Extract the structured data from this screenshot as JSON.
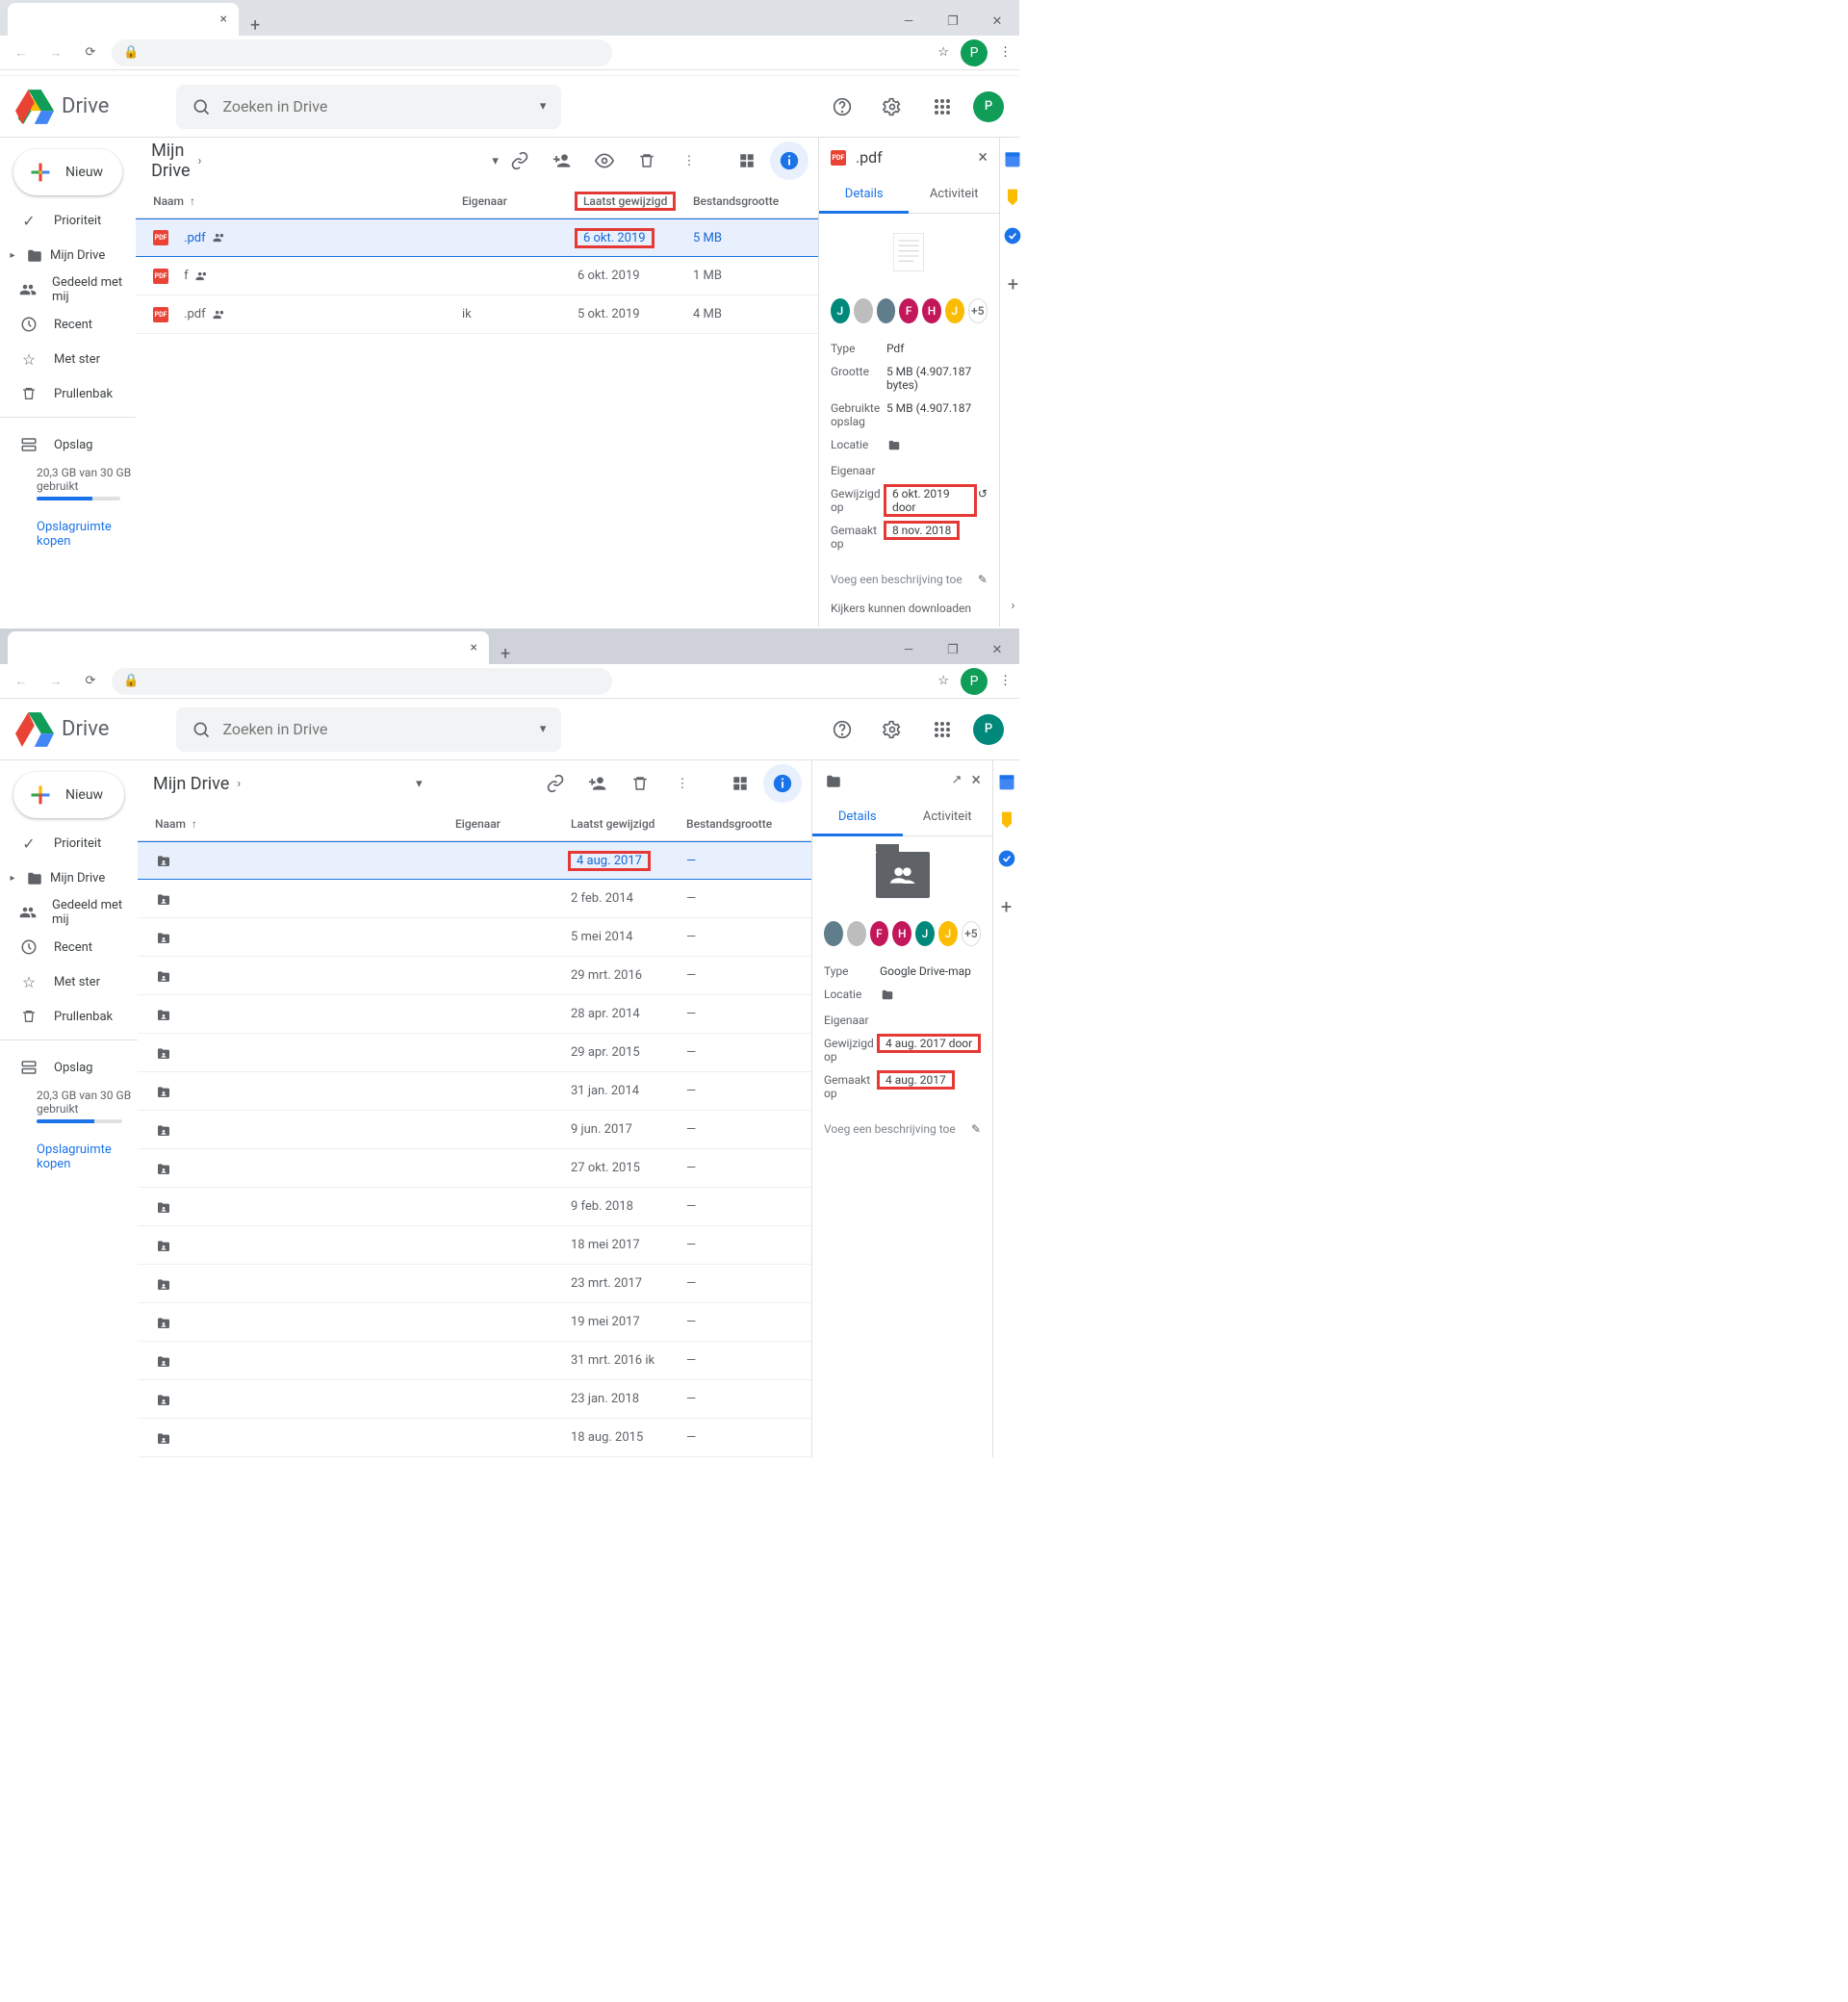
{
  "browser": {
    "win_min": "—",
    "win_max": "❐",
    "win_close": "✕",
    "tab_close": "×",
    "tab_plus": "+",
    "star": "☆",
    "menu": "⋮"
  },
  "avatar_letter": "P",
  "drive": {
    "product": "Drive",
    "search_placeholder": "Zoeken in Drive",
    "new_label": "Nieuw",
    "sidebar": {
      "priority": "Prioriteit",
      "mydrive": "Mijn Drive",
      "shared": "Gedeeld met mij",
      "recent": "Recent",
      "starred": "Met ster",
      "trash": "Prullenbak",
      "storage": "Opslag",
      "storage_text": "20,3 GB van 30 GB gebruikt",
      "upgrade": "Opslagruimte kopen"
    },
    "breadcrumb": "Mijn Drive",
    "cols": {
      "name": "Naam",
      "owner": "Eigenaar",
      "date": "Laatst gewijzigd",
      "size": "Bestandsgrootte"
    },
    "tabs": {
      "details": "Details",
      "activity": "Activiteit"
    },
    "detail_labels": {
      "type": "Type",
      "size": "Grootte",
      "storage_used": "Gebruikte opslag",
      "location": "Locatie",
      "owner": "Eigenaar",
      "modified": "Gewijzigd op",
      "created": "Gemaakt op",
      "add_desc": "Voeg een beschrijving toe",
      "viewers_dl": "Kijkers kunnen downloaden"
    }
  },
  "top": {
    "rows": [
      {
        "name": ".pdf",
        "shared": true,
        "owner": "",
        "date": "6 okt. 2019",
        "size": "5 MB",
        "sel": true,
        "hl_date": true
      },
      {
        "name": "f",
        "shared": true,
        "owner": "",
        "date": "6 okt. 2019",
        "size": "1 MB"
      },
      {
        "name": ".pdf",
        "shared": true,
        "owner": "ik",
        "date": "5 okt. 2019",
        "size": "4 MB"
      }
    ],
    "details": {
      "title": ".pdf",
      "type": "Pdf",
      "size": "5 MB (4.907.187 bytes)",
      "storage_used": "5 MB (4.907.187",
      "modified": "6 okt. 2019 door",
      "created": "8 nov. 2018",
      "avatars": [
        {
          "bg": "#00897b",
          "t": "J"
        },
        {
          "bg": "#bdbdbd",
          "t": ""
        },
        {
          "bg": "#607d8b",
          "t": ""
        },
        {
          "bg": "#c2185b",
          "t": "F"
        },
        {
          "bg": "#c2185b",
          "t": "H"
        },
        {
          "bg": "#fbbc04",
          "t": "J"
        }
      ],
      "more": "+5"
    }
  },
  "bottom": {
    "rows": [
      {
        "date": "4 aug. 2017",
        "size": "—",
        "sel": true,
        "hl_date": true
      },
      {
        "date": "2 feb. 2014",
        "size": "—"
      },
      {
        "date": "5 mei 2014",
        "size": "—"
      },
      {
        "date": "29 mrt. 2016",
        "size": "—"
      },
      {
        "date": "28 apr. 2014",
        "size": "—"
      },
      {
        "date": "29 apr. 2015",
        "size": "—"
      },
      {
        "date": "31 jan. 2014",
        "size": "—"
      },
      {
        "date": "9 jun. 2017",
        "size": "—"
      },
      {
        "date": "27 okt. 2015",
        "size": "—"
      },
      {
        "date": "9 feb. 2018",
        "size": "—"
      },
      {
        "date": "18 mei 2017",
        "size": "—"
      },
      {
        "date": "23 mrt. 2017",
        "size": "—"
      },
      {
        "date": "19 mei 2017",
        "size": "—"
      },
      {
        "date": "31 mrt. 2016 ik",
        "size": "—"
      },
      {
        "date": "23 jan. 2018",
        "size": "—"
      },
      {
        "date": "18 aug. 2015",
        "size": "—"
      }
    ],
    "details": {
      "title": "",
      "type": "Google Drive-map",
      "modified": "4 aug. 2017 door",
      "created": "4 aug. 2017",
      "avatars": [
        {
          "bg": "#607d8b",
          "t": ""
        },
        {
          "bg": "#bdbdbd",
          "t": ""
        },
        {
          "bg": "#c2185b",
          "t": "F"
        },
        {
          "bg": "#c2185b",
          "t": "H"
        },
        {
          "bg": "#00897b",
          "t": "J"
        },
        {
          "bg": "#fbbc04",
          "t": "J"
        }
      ],
      "more": "+5"
    }
  }
}
